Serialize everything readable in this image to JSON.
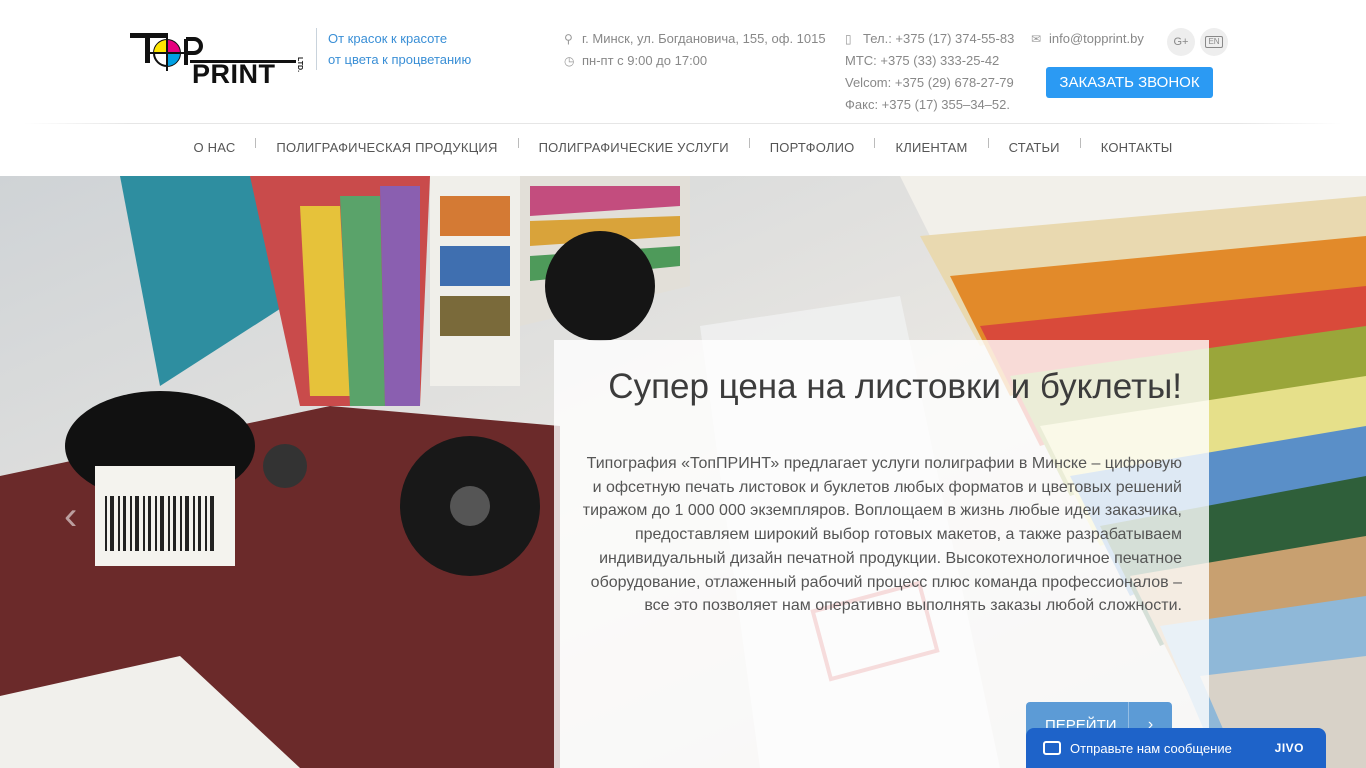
{
  "header": {
    "logo_text": "TOPPRINT LTD.",
    "tagline": [
      "От красок к красоте",
      "от цвета к процветанию"
    ],
    "address": "г. Минск, ул. Богдановича, 155, оф. 1015",
    "hours": "пн-пт с 9:00 до 17:00",
    "phones": [
      "Тел.: +375 (17) 374-55-83",
      "МТС: +375 (33) 333-25-42",
      "Velcom: +375 (29) 678-27-79",
      "Факс: +375 (17) 355–34–52."
    ],
    "email": "info@topprint.by",
    "social_google": "G+",
    "lang": "EN",
    "call_button": "ЗАКАЗАТЬ ЗВОНОК"
  },
  "nav": {
    "items": [
      "О НАС",
      "ПОЛИГРАФИЧЕСКАЯ ПРОДУКЦИЯ",
      "ПОЛИГРАФИЧЕСКИЕ УСЛУГИ",
      "ПОРТФОЛИО",
      "КЛИЕНТАМ",
      "СТАТЬИ",
      "КОНТАКТЫ"
    ]
  },
  "hero": {
    "prev_arrow": "‹",
    "title": "Супер цена на листовки и буклеты!",
    "text": "Типография «ТопПРИНТ» предлагает услуги полиграфии в Минске – цифровую и офсетную печать листовок и буклетов любых форматов и цветовых решений тиражом до 1 000 000 экземпляров. Воплощаем в жизнь любые идеи заказчика, предоставляем широкий выбор готовых макетов, а также разрабатываем индивидуальный дизайн печатной продукции. Высокотехнологичное печатное оборудование, отлаженный рабочий процесс плюс команда профессионалов – все это позволяет нам оперативно выполнять заказы любой сложности.",
    "button": "ПЕРЕЙТИ",
    "button_arrow": "›"
  },
  "chat": {
    "label": "Отправьте нам сообщение",
    "brand": "JIVO"
  },
  "colors": {
    "accent": "#2b9af3",
    "link": "#3a8fd6",
    "chat": "#1e63c9"
  }
}
